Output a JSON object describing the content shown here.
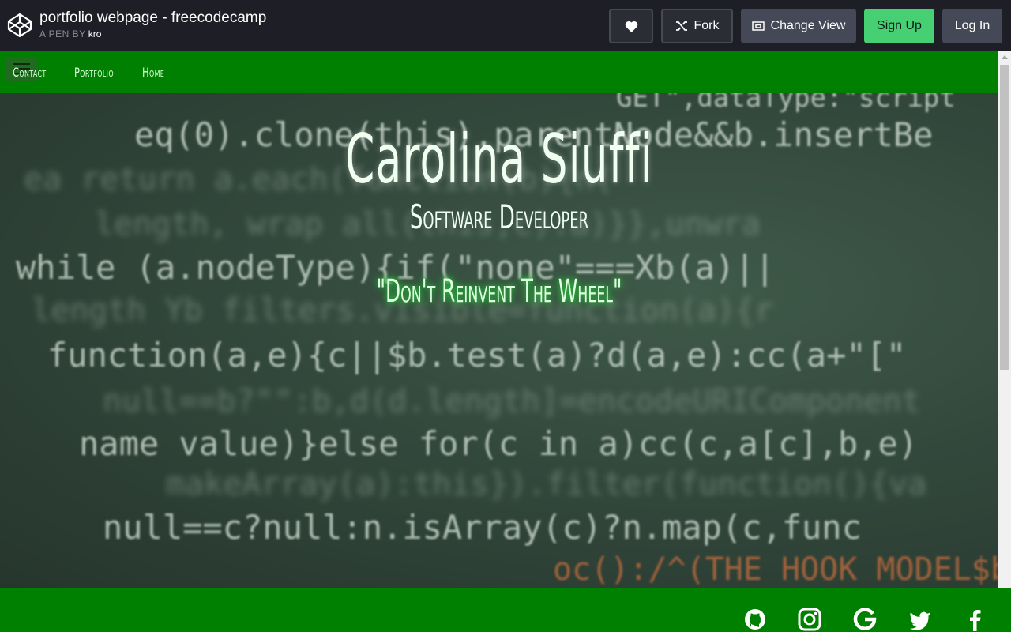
{
  "codepen": {
    "title": "portfolio webpage - freecodecamp",
    "byline_prefix": "A PEN BY",
    "author": "kro",
    "buttons": {
      "like_icon": "heart-icon",
      "fork_label": "Fork",
      "change_view_label": "Change View",
      "sign_up_label": "Sign Up",
      "log_in_label": "Log In"
    },
    "colors": {
      "header_bg": "#1e1f26",
      "sign_up_bg": "#47cf73",
      "secondary_bg": "#444857"
    }
  },
  "pen": {
    "nav": {
      "items": [
        {
          "label": "Contact"
        },
        {
          "label": "Portfolio"
        },
        {
          "label": "Home"
        }
      ],
      "menu_icon": "hamburger-icon"
    },
    "hero": {
      "name": "Carolina Siuffi",
      "role": "Software Developer",
      "quote": "\"Don't Reinvent The Wheel\"",
      "background_code_lines": [
        "GET\",dataType:\"script",
        "eq(0).clone(this).parentNode&&b.insertBe",
        "ea return a.each(function(b){n(",
        "length, wrap all(this,c):a)}},unwra",
        "while (a.nodeType){if(\"none\"===Xb(a)||",
        "length Yb filters.visible=function(a){r",
        "function(a,e){c||$b.test(a)?d(a,e):cc(a+\"[\"",
        "null==b?\"\":b,d(d.length]=encodeURIComponent",
        "name value)}else for(c in a)cc(c,a[c],b,e)",
        "makeArray(a):this}).filter(function(){va",
        "null==c?null:n.isArray(c)?n.map(c,func",
        "oc():/^(THE HOOK MODEL$b="
      ]
    },
    "footer": {
      "social_icons": [
        "github-icon",
        "instagram-icon",
        "google-icon",
        "twitter-icon",
        "facebook-icon"
      ]
    },
    "colors": {
      "nav_bg": "#008000",
      "footer_bg": "#008000",
      "quote_glow": "#25c43a"
    }
  }
}
